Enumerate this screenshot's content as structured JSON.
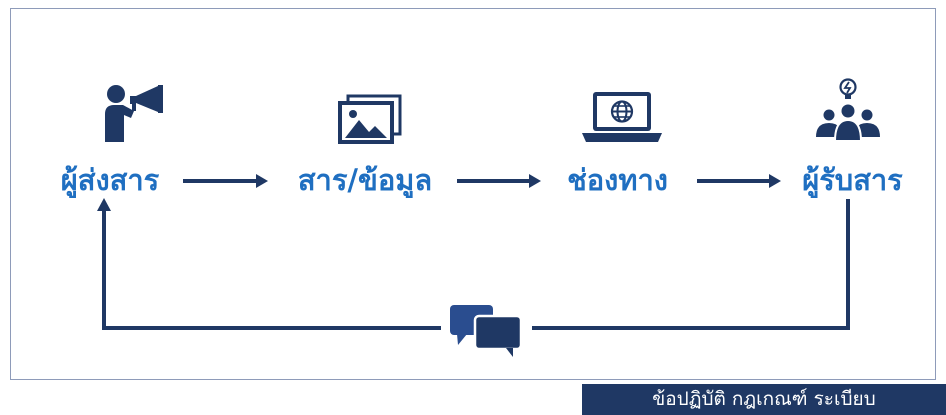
{
  "nodes": [
    {
      "label": "ผู้ส่งสาร",
      "icon": "megaphone-person-icon"
    },
    {
      "label": "สาร/ข้อมูล",
      "icon": "pictures-icon"
    },
    {
      "label": "ช่องทาง",
      "icon": "laptop-globe-icon"
    },
    {
      "label": "ผู้รับสาร",
      "icon": "audience-lightbulb-icon"
    }
  ],
  "feedback": {
    "icon": "chat-bubbles-icon"
  },
  "footer": {
    "text": "ข้อปฏิบัติ กฎเกณฑ์ ระเบียบ"
  },
  "colors": {
    "icon": "#1f3864",
    "label": "#1f6fc1",
    "arrow": "#1f3864",
    "border": "#8e9bb9",
    "footer_bg": "#1f3864",
    "footer_text": "#ffffff"
  }
}
